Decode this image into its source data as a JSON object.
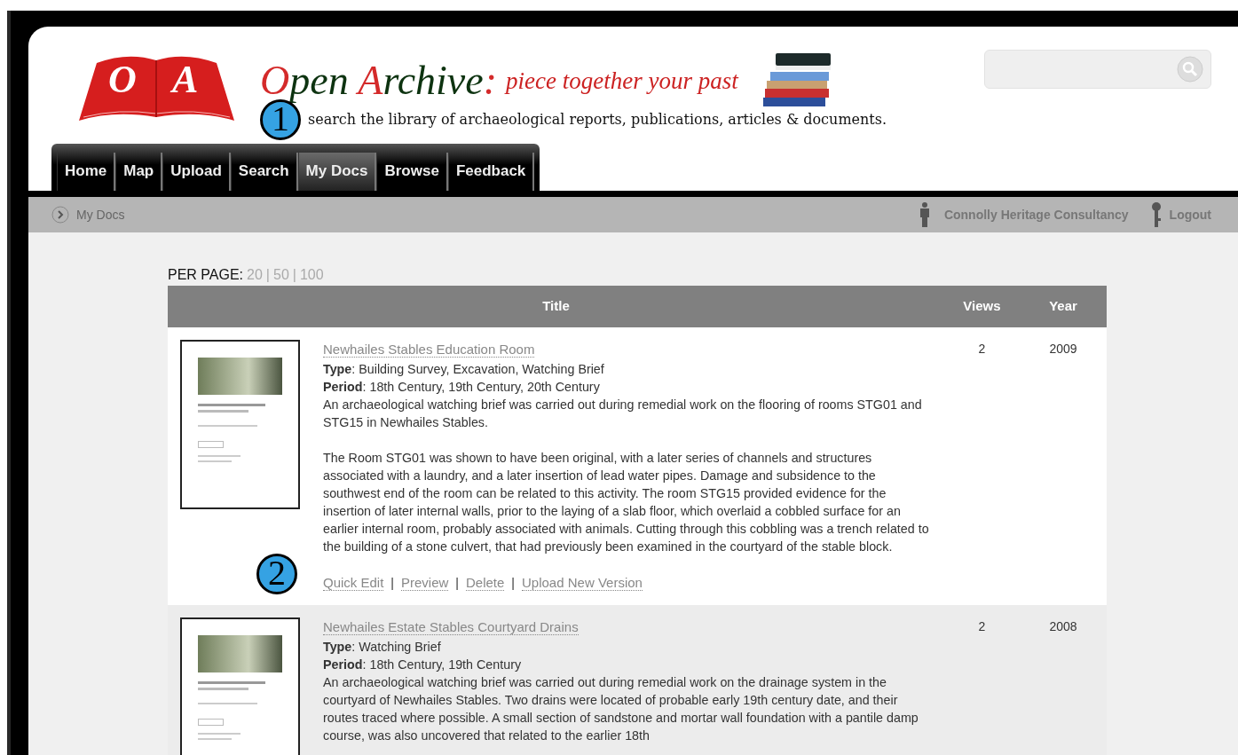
{
  "logo": {
    "letters": [
      "O",
      "A"
    ]
  },
  "site_title": [
    {
      "text": "O",
      "accent": true
    },
    {
      "text": "pen ",
      "accent": false
    },
    {
      "text": "A",
      "accent": true
    },
    {
      "text": "rchive",
      "accent": false
    },
    {
      "text": ":",
      "accent": true
    }
  ],
  "motto": "piece together your past",
  "tagline": "search the library of archaeological reports, publications, articles & documents.",
  "callouts": [
    "1",
    "2"
  ],
  "nav": [
    {
      "label": "Home",
      "selected": false
    },
    {
      "label": "Map",
      "selected": false
    },
    {
      "label": "Upload",
      "selected": false
    },
    {
      "label": "Search",
      "selected": false
    },
    {
      "label": "My Docs",
      "selected": true
    },
    {
      "label": "Browse",
      "selected": false
    },
    {
      "label": "Feedback",
      "selected": false
    }
  ],
  "breadcrumb": "My Docs",
  "user": "Connolly Heritage Consultancy",
  "logout": "Logout",
  "per_page": {
    "label": "PER PAGE:",
    "separator": "|",
    "options": [
      "20",
      "50",
      "100"
    ]
  },
  "table": {
    "action_separator": "|",
    "columns": [
      "Title",
      "Views",
      "Year"
    ],
    "rows": [
      {
        "title": "Newhailes Stables Education Room",
        "type": "**Type**: Building Survey, Excavation, Watching Brief",
        "period": "**Period**: 18th Century, 19th Century, 20th Century",
        "paragraphs": [
          "An archaeological watching brief was carried out during remedial work on the flooring of rooms STG01 and STG15 in Newhailes Stables.",
          "The Room STG01 was shown to have been original, with a later series of channels and structures associated with a laundry, and a later insertion of lead water pipes. Damage and subsidence to the southwest end of the room can be related to this activity. The room STG15 provided evidence for the insertion of later internal walls, prior to the laying of a slab floor, which overlaid a cobbled surface for an earlier internal room, probably associated with animals. Cutting through this cobbling was a trench related to the building of a stone culvert, that had previously been examined in the courtyard of the stable block."
        ],
        "actions": [
          "Quick Edit",
          "Preview",
          "Delete",
          "Upload New Version"
        ],
        "views": "2",
        "year": "2009"
      },
      {
        "title": "Newhailes Estate Stables Courtyard Drains",
        "type": "**Type**: Watching Brief",
        "period": "**Period**: 18th Century, 19th Century",
        "paragraphs": [
          "An archaeological watching brief was carried out during remedial work on the drainage system in the courtyard of Newhailes Stables. Two drains were located of probable early 19th century date, and their routes traced where possible. A small section of sandstone and mortar wall foundation with a pantile damp course, was also uncovered that related to the earlier 18th"
        ],
        "actions": [],
        "views": "2",
        "year": "2008"
      }
    ]
  }
}
